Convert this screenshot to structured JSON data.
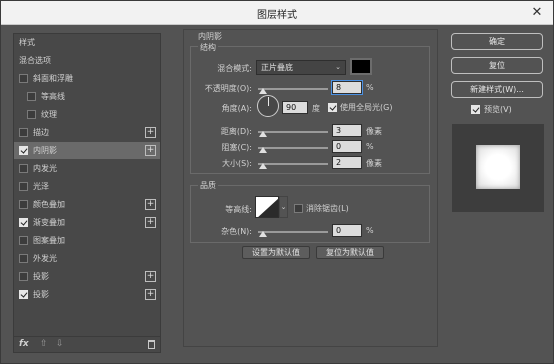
{
  "window": {
    "title": "图层样式",
    "close_glyph": "✕"
  },
  "stylelist": {
    "items": [
      {
        "label": "样式",
        "kind": "header"
      },
      {
        "label": "混合选项",
        "kind": "header"
      },
      {
        "label": "斜面和浮雕",
        "kind": "check",
        "checked": false
      },
      {
        "label": "等高线",
        "kind": "sub",
        "checked": false
      },
      {
        "label": "纹理",
        "kind": "sub",
        "checked": false
      },
      {
        "label": "描边",
        "kind": "check",
        "checked": false,
        "plus": true
      },
      {
        "label": "内阴影",
        "kind": "check",
        "checked": true,
        "plus": true,
        "selected": true
      },
      {
        "label": "内发光",
        "kind": "check",
        "checked": false
      },
      {
        "label": "光泽",
        "kind": "check",
        "checked": false
      },
      {
        "label": "颜色叠加",
        "kind": "check",
        "checked": false,
        "plus": true
      },
      {
        "label": "渐变叠加",
        "kind": "check",
        "checked": true,
        "plus": true
      },
      {
        "label": "图案叠加",
        "kind": "check",
        "checked": false
      },
      {
        "label": "外发光",
        "kind": "check",
        "checked": false
      },
      {
        "label": "投影",
        "kind": "check",
        "checked": false,
        "plus": true
      },
      {
        "label": "投影",
        "kind": "check",
        "checked": true,
        "plus": true
      }
    ],
    "plus_glyph": "+",
    "fx_label": "fx",
    "up_glyph": "⇧",
    "down_glyph": "⇩"
  },
  "inner_shadow": {
    "section_title": "内阴影",
    "structure_title": "结构",
    "blend_mode_label": "混合模式:",
    "blend_mode_value": "正片叠底",
    "shadow_color": "#000000",
    "opacity_label": "不透明度(O):",
    "opacity_value": "8",
    "opacity_unit": "%",
    "angle_label": "角度(A):",
    "angle_value": "90",
    "angle_unit": "度",
    "global_light_label": "使用全局光(G)",
    "global_light_checked": true,
    "distance_label": "距离(D):",
    "distance_value": "3",
    "distance_unit": "像素",
    "choke_label": "阻塞(C):",
    "choke_value": "0",
    "choke_unit": "%",
    "size_label": "大小(S):",
    "size_value": "2",
    "size_unit": "像素",
    "quality_title": "品质",
    "contour_label": "等高线:",
    "antialias_label": "消除锯齿(L)",
    "antialias_checked": false,
    "noise_label": "杂色(N):",
    "noise_value": "0",
    "noise_unit": "%",
    "set_default_label": "设置为默认值",
    "reset_default_label": "复位为默认值"
  },
  "buttons": {
    "ok": "确定",
    "reset": "复位",
    "new_style": "新建样式(W)...",
    "preview_label": "预览(V)",
    "preview_checked": true
  },
  "colors": {
    "panel_bg": "#535353",
    "list_bg": "#484848",
    "selected_row": "#6a6a6a",
    "focus_ring": "#4a90e2"
  }
}
